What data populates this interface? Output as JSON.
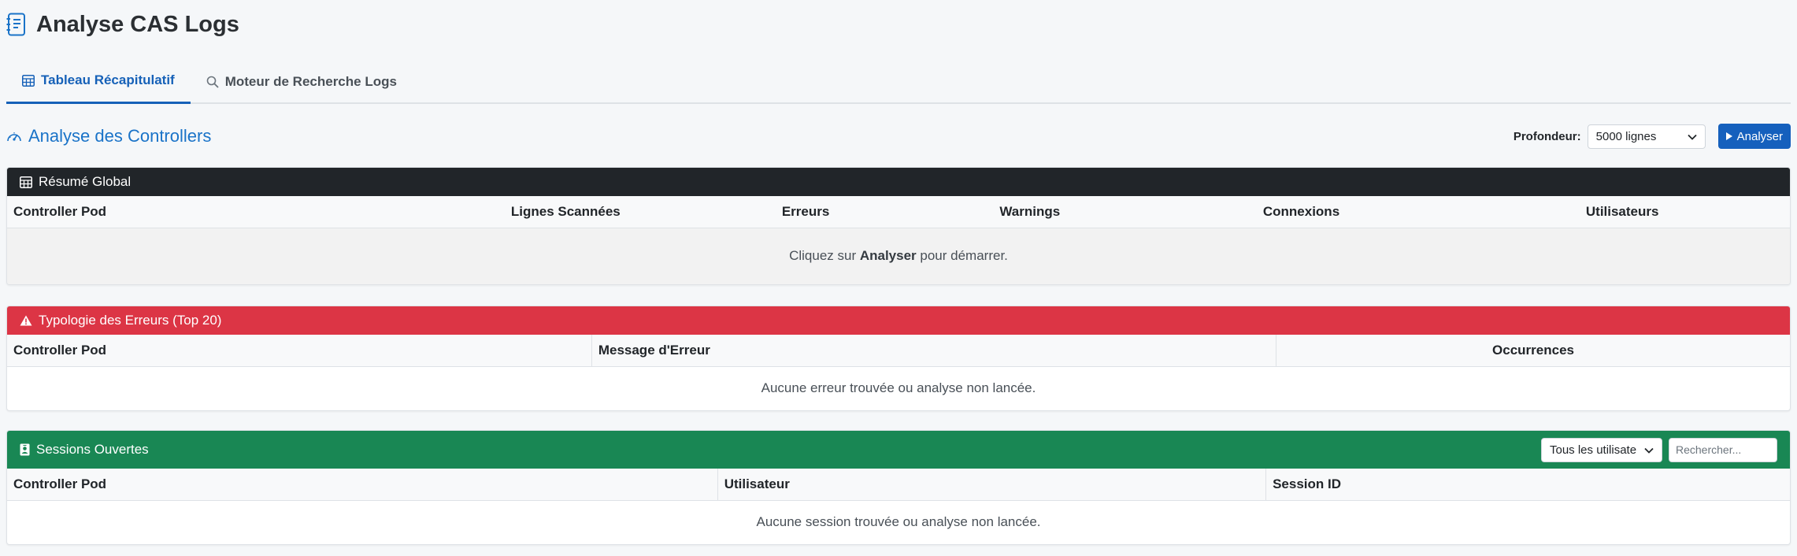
{
  "app": {
    "title": "Analyse CAS Logs"
  },
  "tabs": [
    {
      "label": "Tableau Récapitulatif",
      "active": true
    },
    {
      "label": "Moteur de Recherche Logs",
      "active": false
    }
  ],
  "section": {
    "title": "Analyse des Controllers",
    "depth_label": "Profondeur:",
    "depth_value": "5000 lignes",
    "analyze_label": "Analyser"
  },
  "summary": {
    "title": "Résumé Global",
    "columns": [
      "Controller Pod",
      "Lignes Scannées",
      "Erreurs",
      "Warnings",
      "Connexions",
      "Utilisateurs"
    ],
    "empty_prefix": "Cliquez sur ",
    "empty_bold": "Analyser",
    "empty_suffix": " pour démarrer."
  },
  "errors": {
    "title": "Typologie des Erreurs (Top 20)",
    "columns": [
      "Controller Pod",
      "Message d'Erreur",
      "Occurrences"
    ],
    "empty": "Aucune erreur trouvée ou analyse non lancée."
  },
  "sessions": {
    "title": "Sessions Ouvertes",
    "user_filter": "Tous les utilisate",
    "search_placeholder": "Rechercher...",
    "columns": [
      "Controller Pod",
      "Utilisateur",
      "Session ID"
    ],
    "empty": "Aucune session trouvée ou analyse non lancée."
  },
  "colors": {
    "primary": "#1560bd",
    "dark": "#212529",
    "danger": "#dc3545",
    "success": "#198754"
  },
  "icons": {
    "logo": "journal-text-icon",
    "tab1": "table-icon",
    "tab2": "search-icon",
    "section": "speedometer-icon",
    "analyze": "play-icon",
    "summary": "table-icon",
    "errors": "warning-icon",
    "sessions": "person-badge-icon"
  }
}
